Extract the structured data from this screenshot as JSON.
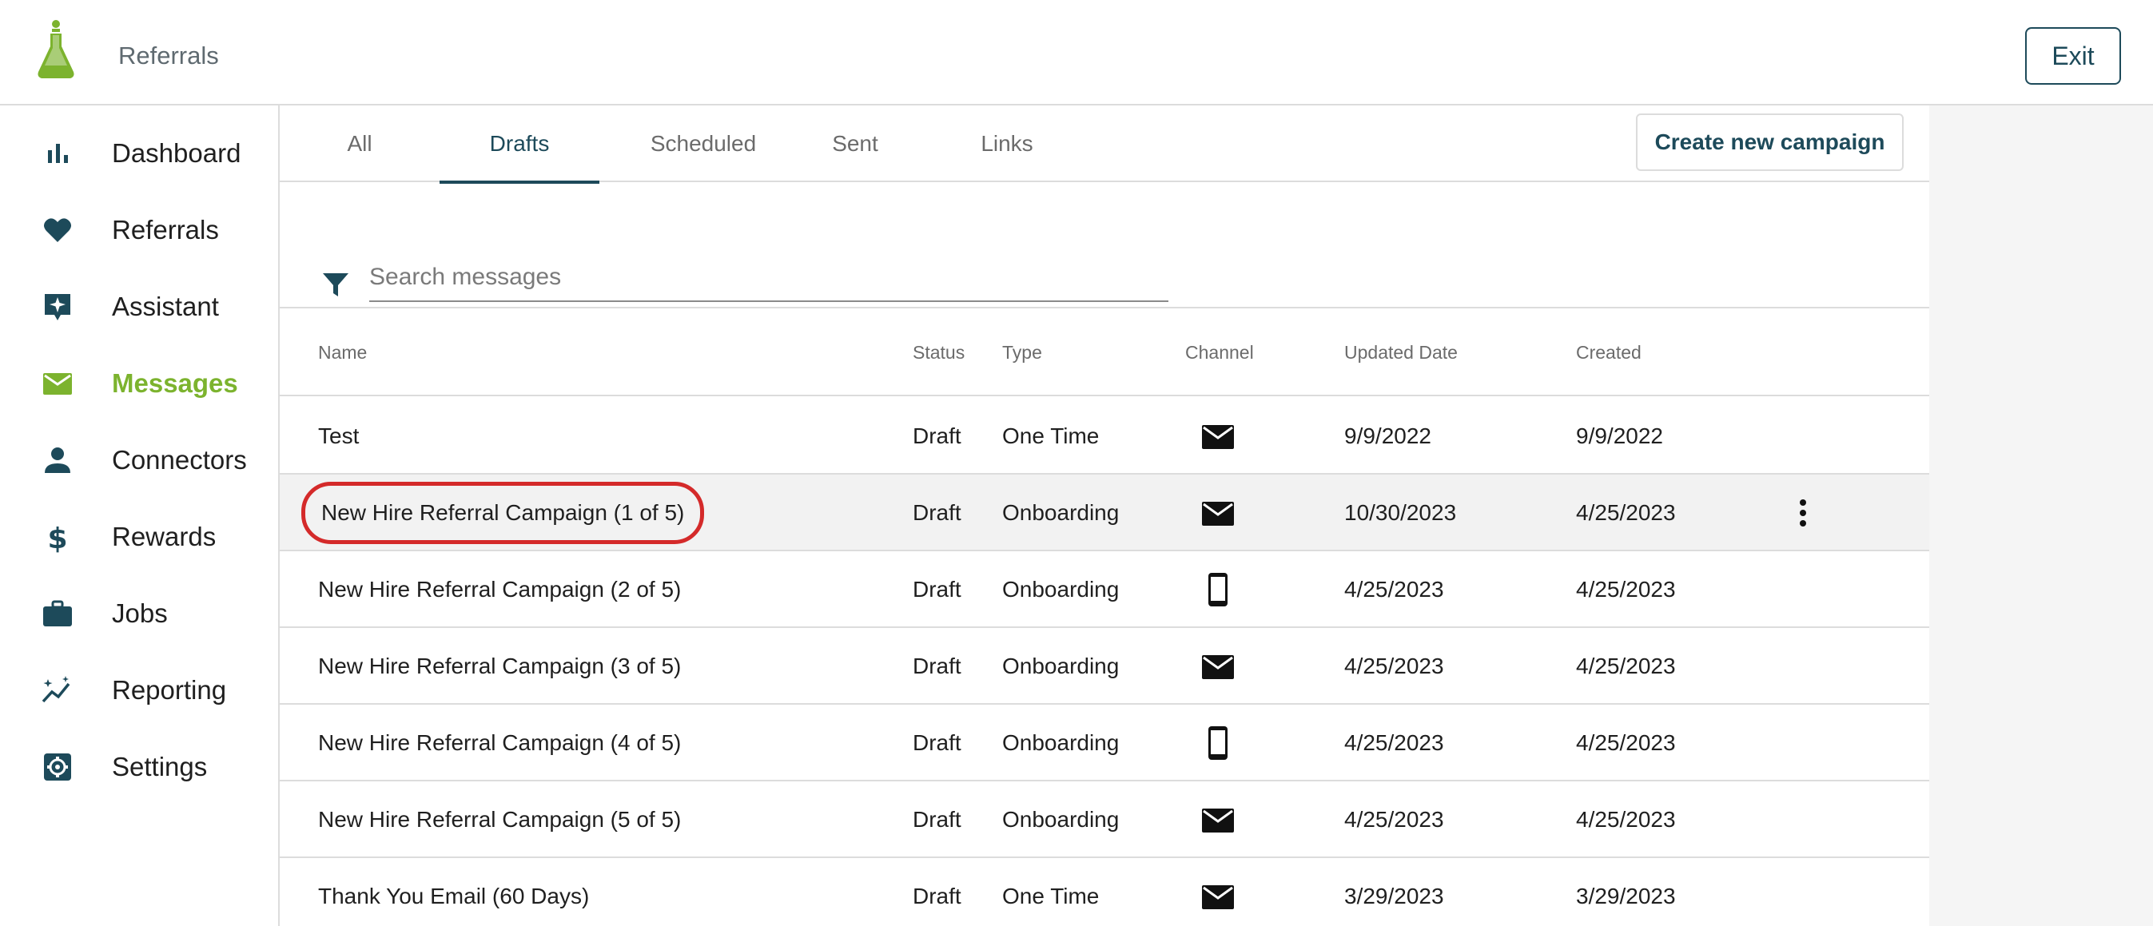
{
  "header": {
    "app_title": "Referrals",
    "exit_label": "Exit"
  },
  "colors": {
    "brand_teal": "#1d4a5a",
    "accent_green": "#7cb32e",
    "highlight_red": "#d42a2a"
  },
  "sidebar": {
    "active": "Messages",
    "items": [
      {
        "label": "Dashboard",
        "icon": "bar-chart-icon"
      },
      {
        "label": "Referrals",
        "icon": "heart-icon"
      },
      {
        "label": "Assistant",
        "icon": "sparkle-icon"
      },
      {
        "label": "Messages",
        "icon": "envelope-icon"
      },
      {
        "label": "Connectors",
        "icon": "person-icon"
      },
      {
        "label": "Rewards",
        "icon": "dollar-icon"
      },
      {
        "label": "Jobs",
        "icon": "briefcase-icon"
      },
      {
        "label": "Reporting",
        "icon": "trend-icon"
      },
      {
        "label": "Settings",
        "icon": "gear-icon"
      }
    ]
  },
  "tabs": {
    "active": "Drafts",
    "items": [
      {
        "label": "All"
      },
      {
        "label": "Drafts"
      },
      {
        "label": "Scheduled"
      },
      {
        "label": "Sent"
      },
      {
        "label": "Links"
      }
    ],
    "create_label": "Create new campaign"
  },
  "search": {
    "placeholder": "Search messages",
    "value": ""
  },
  "table": {
    "columns": {
      "name": "Name",
      "status": "Status",
      "type": "Type",
      "channel": "Channel",
      "updated": "Updated Date",
      "created": "Created"
    },
    "rows": [
      {
        "name": "Test",
        "status": "Draft",
        "type": "One Time",
        "channel": "email-icon",
        "updated": "9/9/2022",
        "created": "9/9/2022"
      },
      {
        "name": "New Hire Referral Campaign (1 of 5)",
        "status": "Draft",
        "type": "Onboarding",
        "channel": "email-icon",
        "updated": "10/30/2023",
        "created": "4/25/2023"
      },
      {
        "name": "New Hire Referral Campaign (2 of 5)",
        "status": "Draft",
        "type": "Onboarding",
        "channel": "phone-icon",
        "updated": "4/25/2023",
        "created": "4/25/2023"
      },
      {
        "name": "New Hire Referral Campaign (3 of 5)",
        "status": "Draft",
        "type": "Onboarding",
        "channel": "email-icon",
        "updated": "4/25/2023",
        "created": "4/25/2023"
      },
      {
        "name": "New Hire Referral Campaign (4 of 5)",
        "status": "Draft",
        "type": "Onboarding",
        "channel": "phone-icon",
        "updated": "4/25/2023",
        "created": "4/25/2023"
      },
      {
        "name": "New Hire Referral Campaign (5 of 5)",
        "status": "Draft",
        "type": "Onboarding",
        "channel": "email-icon",
        "updated": "4/25/2023",
        "created": "4/25/2023"
      },
      {
        "name": "Thank You Email (60 Days)",
        "status": "Draft",
        "type": "One Time",
        "channel": "email-icon",
        "updated": "3/29/2023",
        "created": "3/29/2023"
      }
    ]
  }
}
